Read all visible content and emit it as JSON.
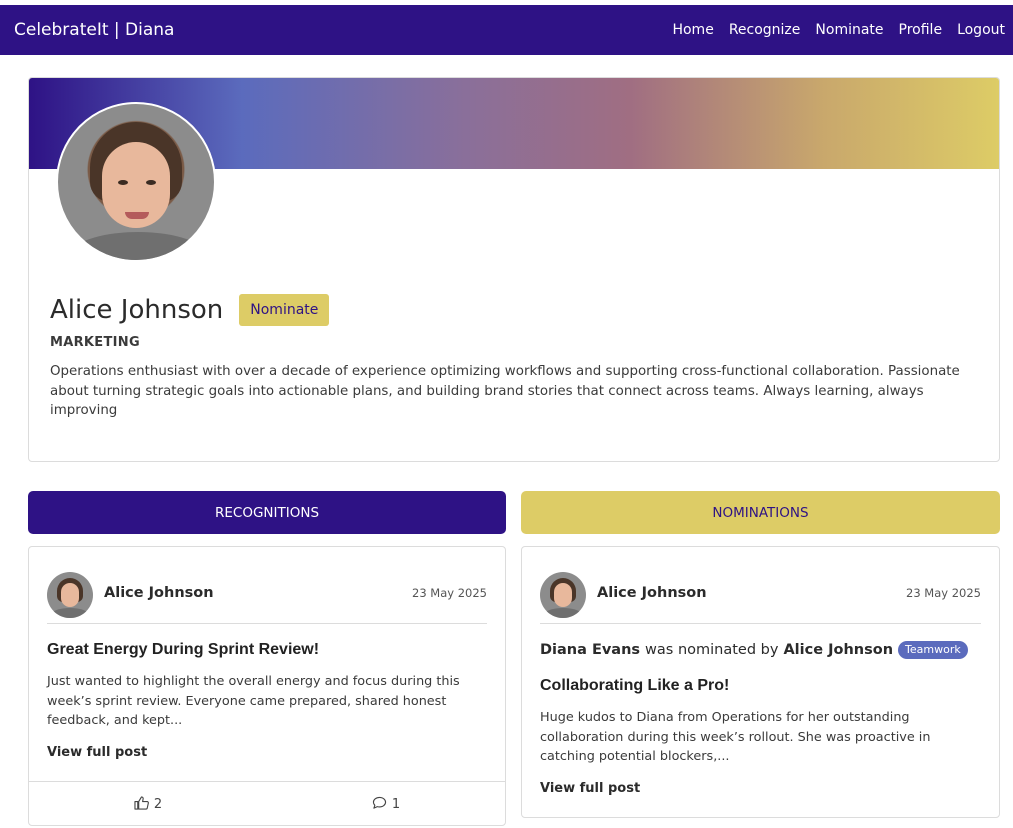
{
  "nav": {
    "brand": "CelebrateIt | Diana",
    "links": [
      "Home",
      "Recognize",
      "Nominate",
      "Profile",
      "Logout"
    ]
  },
  "profile": {
    "name": "Alice Johnson",
    "nominate_label": "Nominate",
    "department": "MARKETING",
    "bio": "Operations enthusiast with over a decade of experience optimizing workflows and supporting cross-functional collaboration. Passionate about turning strategic goals into actionable plans, and building brand stories that connect across teams. Always learning, always improving"
  },
  "tabs": {
    "recognitions": "RECOGNITIONS",
    "nominations": "NOMINATIONS"
  },
  "recognition_post": {
    "author": "Alice Johnson",
    "date": "23 May 2025",
    "title": "Great Energy During Sprint Review!",
    "body": "Just wanted to highlight the overall energy and focus during this week’s sprint review. Everyone came prepared, shared honest feedback, and kept...",
    "view_label": "View full post",
    "likes": "2",
    "comments": "1"
  },
  "nomination_post": {
    "author": "Alice Johnson",
    "date": "23 May 2025",
    "nominee": "Diana Evans",
    "mid_text": "was nominated by",
    "nominator": "Alice Johnson",
    "badge": "Teamwork",
    "title": "Collaborating Like a Pro!",
    "body": "Huge kudos to Diana from Operations for her outstanding collaboration during this week’s rollout. She was proactive in catching potential blockers,...",
    "view_label": "View full post"
  },
  "colors": {
    "primary": "#2e1285",
    "accent": "#ddcc66",
    "badge": "#5b6bbd"
  }
}
